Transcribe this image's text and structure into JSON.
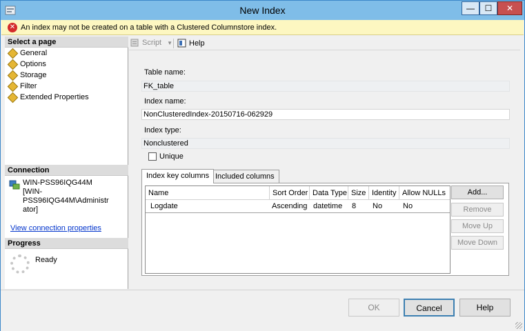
{
  "window": {
    "title": "New Index",
    "minimize_glyph": "—",
    "maximize_glyph": "☐",
    "close_glyph": "✕"
  },
  "error": {
    "icon": "error-icon",
    "icon_glyph": "✕",
    "message": "An index may not be created on a table with a Clustered Columnstore index."
  },
  "sidebar": {
    "select_page_header": "Select a page",
    "pages": [
      {
        "label": "General"
      },
      {
        "label": "Options"
      },
      {
        "label": "Storage"
      },
      {
        "label": "Filter"
      },
      {
        "label": "Extended Properties"
      }
    ],
    "connection_header": "Connection",
    "connection_line1": "WIN-PSS96IQG44M",
    "connection_line2": "[WIN-PSS96IQG44M\\Administr",
    "connection_line3": "ator]",
    "view_connection_link": "View connection properties",
    "progress_header": "Progress",
    "progress_status": "Ready"
  },
  "toolbar": {
    "script_label": "Script",
    "help_label": "Help"
  },
  "general": {
    "table_name_label": "Table name:",
    "table_name_value": "FK_table",
    "index_name_label": "Index name:",
    "index_name_value": "NonClusteredIndex-20150716-062929",
    "index_type_label": "Index type:",
    "index_type_value": "Nonclustered",
    "unique_label": "Unique"
  },
  "tabs": {
    "key_columns": "Index key columns",
    "included_columns": "Included columns"
  },
  "grid": {
    "headers": [
      "Name",
      "Sort Order",
      "Data Type",
      "Size",
      "Identity",
      "Allow NULLs"
    ],
    "rows": [
      [
        "Logdate",
        "Ascending",
        "datetime",
        "8",
        "No",
        "No"
      ]
    ]
  },
  "grid_buttons": {
    "add": "Add...",
    "remove": "Remove",
    "move_up": "Move Up",
    "move_down": "Move Down"
  },
  "footer": {
    "ok": "OK",
    "cancel": "Cancel",
    "help": "Help"
  }
}
